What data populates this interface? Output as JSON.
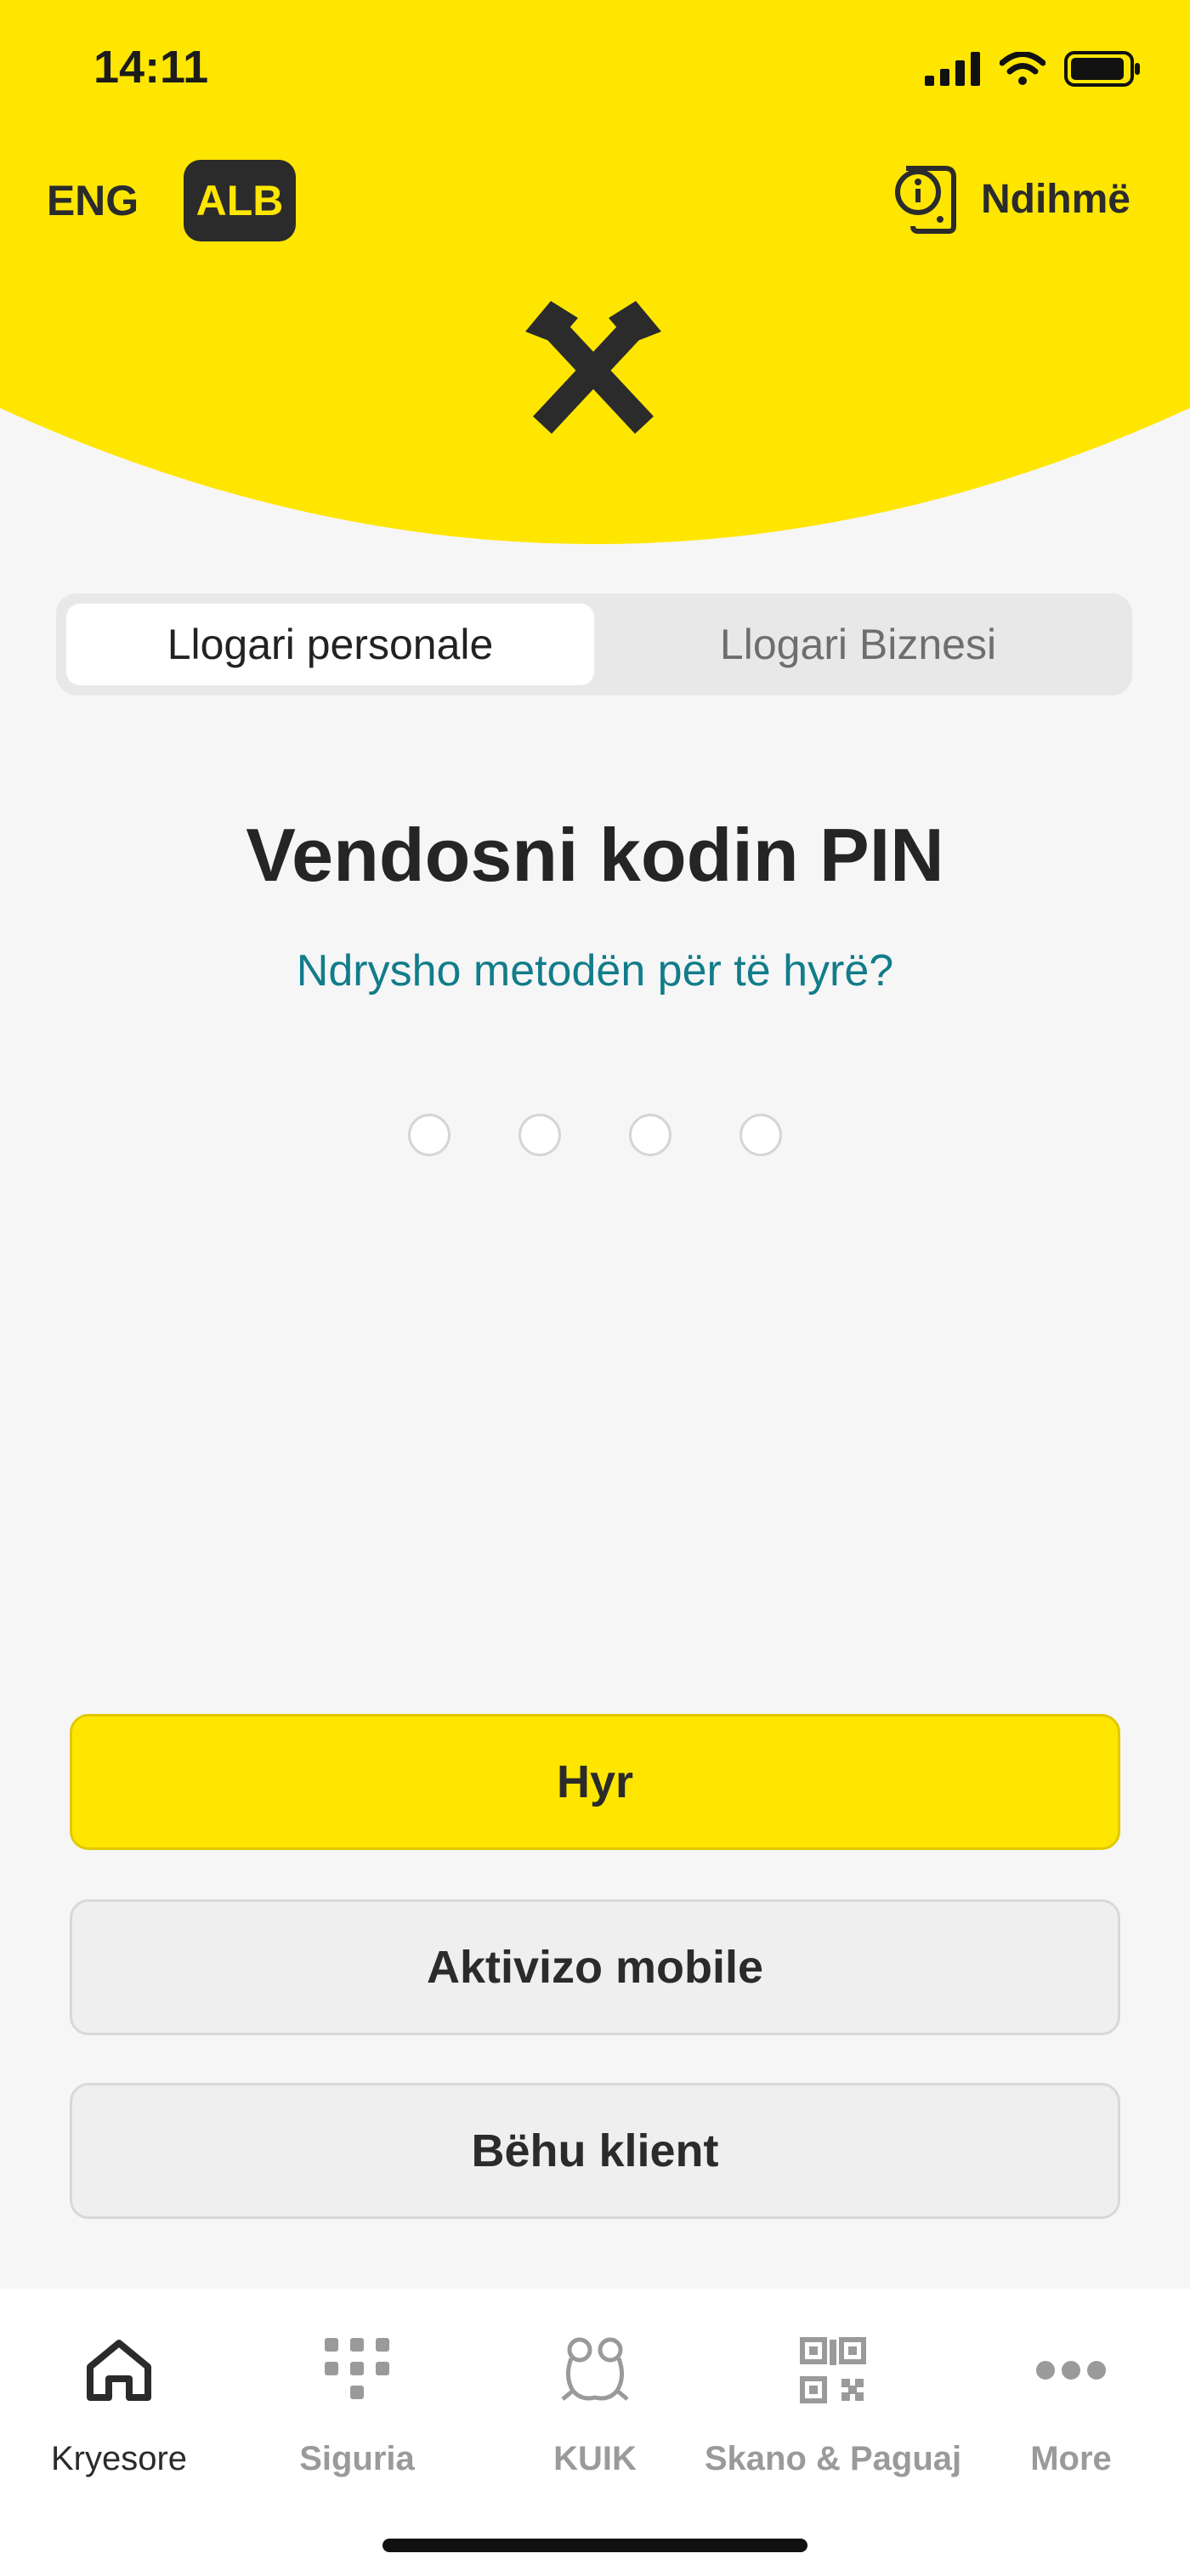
{
  "status_bar": {
    "time": "14:11"
  },
  "header": {
    "lang_options": [
      "ENG",
      "ALB"
    ],
    "selected_lang": "ALB",
    "help_label": "Ndihmë"
  },
  "account_tabs": {
    "personal": "Llogari personale",
    "business": "Llogari Biznesi",
    "selected": "personal"
  },
  "pin": {
    "title": "Vendosni kodin PIN",
    "change_method_link": "Ndrysho metodën për të hyrë?",
    "digits_total": 4,
    "digits_entered": 0
  },
  "buttons": {
    "login": "Hyr",
    "activate": "Aktivizo mobile",
    "become_client": "Bëhu klient"
  },
  "tabbar": {
    "items": [
      {
        "label": "Kryesore",
        "icon": "home-icon",
        "active": true
      },
      {
        "label": "Siguria",
        "icon": "keypad-icon",
        "active": false
      },
      {
        "label": "KUIK",
        "icon": "frog-icon",
        "active": false
      },
      {
        "label": "Skano & Paguaj",
        "icon": "qr-code-icon",
        "active": false
      },
      {
        "label": "More",
        "icon": "more-icon",
        "active": false
      }
    ]
  },
  "colors": {
    "brand_yellow": "#ffe600",
    "dark": "#2b2b2b",
    "link_teal": "#127c8a",
    "background": "#f6f6f6"
  }
}
